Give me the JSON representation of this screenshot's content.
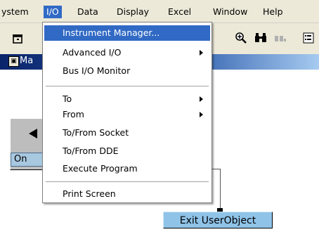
{
  "menubar": {
    "items": [
      {
        "label": "ystem"
      },
      {
        "label": "I/O"
      },
      {
        "label": "Data"
      },
      {
        "label": "Display"
      },
      {
        "label": "Excel"
      },
      {
        "label": "Window"
      },
      {
        "label": "Help"
      }
    ],
    "active_index": 1
  },
  "toolbar": {
    "icons": [
      "open-icon",
      "zoom-icon",
      "binoculars-icon",
      "find-next-icon",
      "properties-icon"
    ]
  },
  "window": {
    "title": "Ma",
    "icon": "window-icon"
  },
  "io_menu": {
    "items": [
      {
        "label": "Instrument Manager...",
        "highlighted": true,
        "submenu": false
      },
      {
        "label": "Advanced I/O",
        "highlighted": false,
        "submenu": true
      },
      {
        "label": "Bus I/O Monitor",
        "highlighted": false,
        "submenu": false
      },
      {
        "label": "To",
        "highlighted": false,
        "submenu": true
      },
      {
        "label": "From",
        "highlighted": false,
        "submenu": true
      },
      {
        "label": "To/From Socket",
        "highlighted": false,
        "submenu": false
      },
      {
        "label": "To/From DDE",
        "highlighted": false,
        "submenu": false
      },
      {
        "label": "Execute Program",
        "highlighted": false,
        "submenu": false
      },
      {
        "label": "Print Screen",
        "highlighted": false,
        "submenu": false
      }
    ]
  },
  "canvas": {
    "on_object_label": "On",
    "exit_object_label": "Exit UserObject"
  },
  "colors": {
    "highlight": "#316ac5",
    "menubar_bg": "#ece9d8",
    "title_blue": "#0a246a",
    "exit_object_bg": "#8fc3e8"
  }
}
